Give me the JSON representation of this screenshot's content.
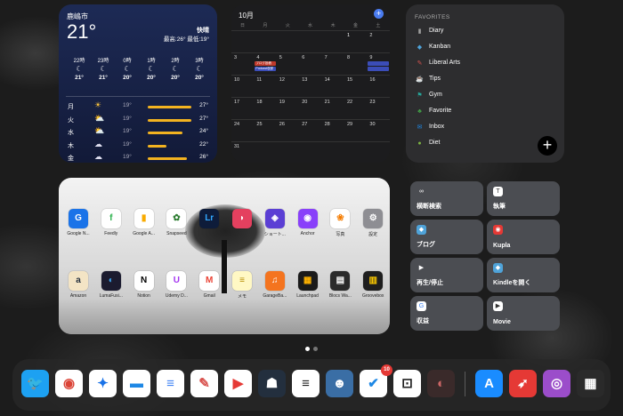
{
  "weather": {
    "city": "鹿嶋市",
    "temp": "21°",
    "condition": "快晴",
    "hilo": "最高:26° 最低:19°",
    "hourly": [
      {
        "label": "22時",
        "icon": "☾",
        "temp": "21°"
      },
      {
        "label": "23時",
        "icon": "☾",
        "temp": "21°"
      },
      {
        "label": "0時",
        "icon": "☾",
        "temp": "20°"
      },
      {
        "label": "1時",
        "icon": "☾",
        "temp": "20°"
      },
      {
        "label": "2時",
        "icon": "☾",
        "temp": "20°"
      },
      {
        "label": "3時",
        "icon": "☾",
        "temp": "20°"
      }
    ],
    "daily": [
      {
        "day": "月",
        "icon": "☀",
        "low": "19°",
        "high": "27°",
        "bar": 0.95
      },
      {
        "day": "火",
        "icon": "⛅",
        "low": "19°",
        "high": "27°",
        "bar": 0.95
      },
      {
        "day": "水",
        "icon": "⛅",
        "low": "19°",
        "high": "24°",
        "bar": 0.75
      },
      {
        "day": "木",
        "icon": "☁",
        "low": "19°",
        "high": "22°",
        "bar": 0.4
      },
      {
        "day": "金",
        "icon": "☁",
        "low": "19°",
        "high": "26°",
        "bar": 0.85
      }
    ]
  },
  "calendar": {
    "month": "10月",
    "add_icon": "+",
    "weekdays": [
      "日",
      "月",
      "火",
      "水",
      "木",
      "金",
      "土"
    ],
    "weeks": [
      [
        "",
        "",
        "",
        "",
        "",
        "1",
        "2"
      ],
      [
        "3",
        "4",
        "5",
        "6",
        "7",
        "8",
        "9"
      ],
      [
        "10",
        "11",
        "12",
        "13",
        "14",
        "15",
        "16"
      ],
      [
        "17",
        "18",
        "19",
        "20",
        "21",
        "22",
        "23"
      ],
      [
        "24",
        "25",
        "26",
        "27",
        "28",
        "29",
        "30"
      ],
      [
        "31",
        "",
        "",
        "",
        "",
        "",
        ""
      ]
    ],
    "chips": [
      {
        "week": 1,
        "col": 1,
        "text": "ブログ投稿",
        "color": "#c0392b"
      },
      {
        "week": 1,
        "col": 1,
        "text": "Podcast収録",
        "color": "#3b4db8"
      },
      {
        "week": 1,
        "col": 6,
        "text": "",
        "color": "#3b4db8"
      },
      {
        "week": 1,
        "col": 6,
        "text": "",
        "color": "#3b4db8"
      }
    ]
  },
  "favorites": {
    "title": "FAVORITES",
    "items": [
      {
        "label": "Diary",
        "icon": "▮",
        "color": "#9e9e9e"
      },
      {
        "label": "Kanban",
        "icon": "◆",
        "color": "#4fa3d9"
      },
      {
        "label": "Liberal Arts",
        "icon": "✎",
        "color": "#d9534f"
      },
      {
        "label": "Tips",
        "icon": "☕",
        "color": "#6d4c41"
      },
      {
        "label": "Gym",
        "icon": "⚑",
        "color": "#26a69a"
      },
      {
        "label": "Favorite",
        "icon": "♣",
        "color": "#43a047"
      },
      {
        "label": "Inbox",
        "icon": "✉",
        "color": "#1e88e5"
      },
      {
        "label": "Diet",
        "icon": "●",
        "color": "#7cb342"
      }
    ],
    "add_icon": "+"
  },
  "apps": [
    {
      "label": "Google N...",
      "icon": "G",
      "bg": "#1a73e8",
      "fg": "#fff"
    },
    {
      "label": "Feedly",
      "icon": "f",
      "bg": "#ffffff",
      "fg": "#2bb24c"
    },
    {
      "label": "Google A...",
      "icon": "▮",
      "bg": "#ffffff",
      "fg": "#f9ab00"
    },
    {
      "label": "Snapseed",
      "icon": "✿",
      "bg": "#ffffff",
      "fg": "#2e7d32"
    },
    {
      "label": "",
      "icon": "Lr",
      "bg": "#0e1c3a",
      "fg": "#31a8ff"
    },
    {
      "label": "",
      "icon": "◗",
      "bg": "#e4405f",
      "fg": "#fff"
    },
    {
      "label": "ショート...",
      "icon": "◈",
      "bg": "#5b3fd4",
      "fg": "#fff"
    },
    {
      "label": "Anchor",
      "icon": "◉",
      "bg": "#8940fa",
      "fg": "#fff"
    },
    {
      "label": "写真",
      "icon": "❀",
      "bg": "#ffffff",
      "fg": "#f57c00"
    },
    {
      "label": "設定",
      "icon": "⚙",
      "bg": "#8e8e93",
      "fg": "#fff"
    },
    {
      "label": "Amazon",
      "icon": "a",
      "bg": "#f3e4c5",
      "fg": "#232f3e"
    },
    {
      "label": "LumaFusi...",
      "icon": "◐",
      "bg": "#1b1b2f",
      "fg": "#3fa9f5"
    },
    {
      "label": "Notion",
      "icon": "N",
      "bg": "#ffffff",
      "fg": "#000"
    },
    {
      "label": "Udemy D...",
      "icon": "U",
      "bg": "#ffffff",
      "fg": "#a435f0"
    },
    {
      "label": "Gmail",
      "icon": "M",
      "bg": "#ffffff",
      "fg": "#ea4335"
    },
    {
      "label": "メモ",
      "icon": "≡",
      "bg": "#fff8c4",
      "fg": "#b58b00"
    },
    {
      "label": "GarageBa...",
      "icon": "♫",
      "bg": "#f4741f",
      "fg": "#fff"
    },
    {
      "label": "Launchpad",
      "icon": "▦",
      "bg": "#1a1a1a",
      "fg": "#ffb300"
    },
    {
      "label": "Blocs Wa...",
      "icon": "▤",
      "bg": "#2a2a2a",
      "fg": "#fff"
    },
    {
      "label": "Groovebox",
      "icon": "▥",
      "bg": "#1f1f1f",
      "fg": "#ffcc00"
    }
  ],
  "shortcuts": [
    {
      "label": "横断検索",
      "icon": "∞",
      "icon_bg": "transparent",
      "icon_fg": "#fff"
    },
    {
      "label": "執筆",
      "icon": "T",
      "icon_bg": "#ffffff",
      "icon_fg": "#333"
    },
    {
      "label": "ブログ",
      "icon": "◆",
      "icon_bg": "#4fa3d9",
      "icon_fg": "#fff"
    },
    {
      "label": "Kupla",
      "icon": "◉",
      "icon_bg": "#e53935",
      "icon_fg": "#fff"
    },
    {
      "label": "再生/停止",
      "icon": "▶",
      "icon_bg": "transparent",
      "icon_fg": "#fff"
    },
    {
      "label": "Kindleを開く",
      "icon": "◆",
      "icon_bg": "#4fa3d9",
      "icon_fg": "#fff"
    },
    {
      "label": "収益",
      "icon": "G",
      "icon_bg": "#ffffff",
      "icon_fg": "#4285f4"
    },
    {
      "label": "Movie",
      "icon": "▶",
      "icon_bg": "#ffffff",
      "icon_fg": "#333"
    }
  ],
  "page_dots": [
    true,
    false
  ],
  "dock": [
    {
      "name": "twitter",
      "icon": "🐦",
      "bg": "#1da1f2",
      "fg": "#fff"
    },
    {
      "name": "chrome",
      "icon": "◉",
      "bg": "#ffffff",
      "fg": "#db4437"
    },
    {
      "name": "safari",
      "icon": "✦",
      "bg": "#ffffff",
      "fg": "#1a73e8"
    },
    {
      "name": "files",
      "icon": "▬",
      "bg": "#ffffff",
      "fg": "#1e88e5"
    },
    {
      "name": "google-docs",
      "icon": "≡",
      "bg": "#ffffff",
      "fg": "#4285f4"
    },
    {
      "name": "bear",
      "icon": "✎",
      "bg": "#ffffff",
      "fg": "#d9534f"
    },
    {
      "name": "youtube",
      "icon": "▶",
      "bg": "#ffffff",
      "fg": "#e53935"
    },
    {
      "name": "kindle",
      "icon": "☗",
      "bg": "#232f3e",
      "fg": "#fff"
    },
    {
      "name": "notes-writer",
      "icon": "≡",
      "bg": "#ffffff",
      "fg": "#222"
    },
    {
      "name": "game",
      "icon": "☻",
      "bg": "#3a6ea5",
      "fg": "#fff"
    },
    {
      "name": "todo",
      "icon": "✔",
      "bg": "#ffffff",
      "fg": "#1e88e5",
      "badge": "10"
    },
    {
      "name": "share-box",
      "icon": "⊡",
      "bg": "#ffffff",
      "fg": "#222"
    },
    {
      "name": "photo-app",
      "icon": "◐",
      "bg": "#3a2a2a",
      "fg": "#c66"
    },
    {
      "name": "app-store",
      "icon": "A",
      "bg": "#1a8cff",
      "fg": "#fff"
    },
    {
      "name": "rocket",
      "icon": "➶",
      "bg": "#e53935",
      "fg": "#fff"
    },
    {
      "name": "podcasts",
      "icon": "◎",
      "bg": "#9b4dca",
      "fg": "#fff"
    },
    {
      "name": "app-library",
      "icon": "▦",
      "bg": "#2a2a2a",
      "fg": "#fff"
    }
  ]
}
